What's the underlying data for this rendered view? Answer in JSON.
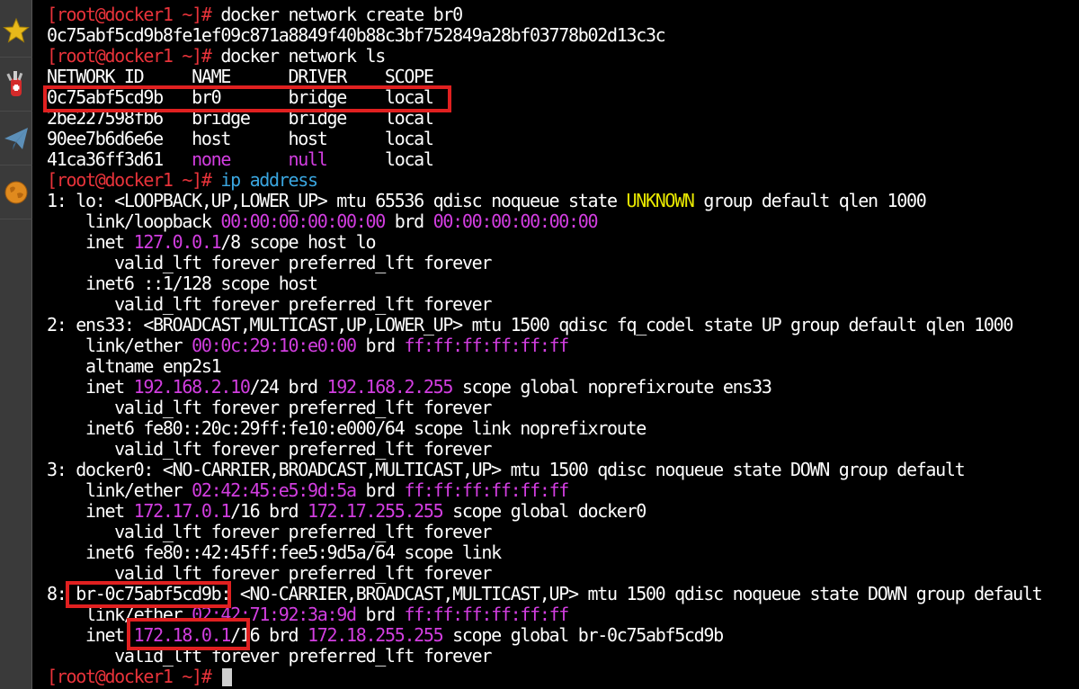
{
  "sidebar": {
    "items": [
      {
        "icon": "star-icon"
      },
      {
        "icon": "swiss-knife-icon"
      },
      {
        "icon": "paper-plane-icon"
      },
      {
        "icon": "globe-icon"
      }
    ]
  },
  "colors": {
    "prompt": "#e8333a",
    "command_accent": "#3aa6e0",
    "value": "#d23ee0",
    "warning": "#e8e800",
    "highlight": "#e02020"
  },
  "terminal": {
    "lines": [
      [
        {
          "t": "[root@docker1 ~]# ",
          "c": "p"
        },
        {
          "t": "docker network create br0"
        }
      ],
      [
        {
          "t": "0c75abf5cd9b8fe1ef09c871a8849f40b88c3bf752849a28bf03778b02d13c3c"
        }
      ],
      [
        {
          "t": "[root@docker1 ~]# ",
          "c": "p"
        },
        {
          "t": "docker network ls"
        }
      ],
      [
        {
          "t": "NETWORK ID     NAME      DRIVER    SCOPE"
        }
      ],
      [
        {
          "t": "0c75abf5cd9b   br0       bridge    local"
        }
      ],
      [
        {
          "t": "2be227598fb6   bridge    bridge    local"
        }
      ],
      [
        {
          "t": "90ee7b6d6e6e   host      host      local"
        }
      ],
      [
        {
          "t": "41ca36ff3d61   "
        },
        {
          "t": "none",
          "c": "m"
        },
        {
          "t": "      "
        },
        {
          "t": "null",
          "c": "m"
        },
        {
          "t": "      local"
        }
      ],
      [
        {
          "t": "[root@docker1 ~]# ",
          "c": "p"
        },
        {
          "t": "ip address",
          "c": "c"
        }
      ],
      [
        {
          "t": "1: lo: <LOOPBACK,UP,LOWER_UP> mtu 65536 qdisc noqueue state "
        },
        {
          "t": "UNKNOWN",
          "c": "y"
        },
        {
          "t": " group default qlen 1000"
        }
      ],
      [
        {
          "t": "    link/loopback "
        },
        {
          "t": "00:00:00:00:00:00",
          "c": "m"
        },
        {
          "t": " brd "
        },
        {
          "t": "00:00:00:00:00:00",
          "c": "m"
        }
      ],
      [
        {
          "t": "    inet "
        },
        {
          "t": "127.0.0.1",
          "c": "m"
        },
        {
          "t": "/8 scope host lo"
        }
      ],
      [
        {
          "t": "       valid_lft forever preferred_lft forever"
        }
      ],
      [
        {
          "t": "    inet6 ::1/128 scope host"
        }
      ],
      [
        {
          "t": "       valid_lft forever preferred_lft forever"
        }
      ],
      [
        {
          "t": "2: ens33: <BROADCAST,MULTICAST,UP,LOWER_UP> mtu 1500 qdisc fq_codel state UP group default qlen 1000"
        }
      ],
      [
        {
          "t": "    link/ether "
        },
        {
          "t": "00:0c:29:10:e0:00",
          "c": "m"
        },
        {
          "t": " brd "
        },
        {
          "t": "ff:ff:ff:ff:ff:ff",
          "c": "m"
        }
      ],
      [
        {
          "t": "    altname enp2s1"
        }
      ],
      [
        {
          "t": "    inet "
        },
        {
          "t": "192.168.2.10",
          "c": "m"
        },
        {
          "t": "/24 brd "
        },
        {
          "t": "192.168.2.255",
          "c": "m"
        },
        {
          "t": " scope global noprefixroute ens33"
        }
      ],
      [
        {
          "t": "       valid_lft forever preferred_lft forever"
        }
      ],
      [
        {
          "t": "    inet6 fe80::20c:29ff:fe10:e000/64 scope link noprefixroute"
        }
      ],
      [
        {
          "t": "       valid_lft forever preferred_lft forever"
        }
      ],
      [
        {
          "t": "3: docker0: <NO-CARRIER,BROADCAST,MULTICAST,UP> mtu 1500 qdisc noqueue state DOWN group default"
        }
      ],
      [
        {
          "t": "    link/ether "
        },
        {
          "t": "02:42:45:e5:9d:5a",
          "c": "m"
        },
        {
          "t": " brd "
        },
        {
          "t": "ff:ff:ff:ff:ff:ff",
          "c": "m"
        }
      ],
      [
        {
          "t": "    inet "
        },
        {
          "t": "172.17.0.1",
          "c": "m"
        },
        {
          "t": "/16 brd "
        },
        {
          "t": "172.17.255.255",
          "c": "m"
        },
        {
          "t": " scope global docker0"
        }
      ],
      [
        {
          "t": "       valid_lft forever preferred_lft forever"
        }
      ],
      [
        {
          "t": "    inet6 fe80::42:45ff:fee5:9d5a/64 scope link"
        }
      ],
      [
        {
          "t": "       valid_lft forever preferred_lft forever"
        }
      ],
      [
        {
          "t": "8: br-0c75abf5cd9b: <NO-CARRIER,BROADCAST,MULTICAST,UP> mtu 1500 qdisc noqueue state DOWN group default"
        }
      ],
      [
        {
          "t": "    link/ether "
        },
        {
          "t": "02:42:71:92:3a:9d",
          "c": "m"
        },
        {
          "t": " brd "
        },
        {
          "t": "ff:ff:ff:ff:ff:ff",
          "c": "m"
        }
      ],
      [
        {
          "t": "    inet "
        },
        {
          "t": "172.18.0.1",
          "c": "m"
        },
        {
          "t": "/16 brd "
        },
        {
          "t": "172.18.255.255",
          "c": "m"
        },
        {
          "t": " scope global br-0c75abf5cd9b"
        }
      ],
      [
        {
          "t": "       valid_lft forever preferred_lft forever"
        }
      ],
      [
        {
          "t": "[root@docker1 ~]# ",
          "c": "p"
        }
      ]
    ]
  }
}
